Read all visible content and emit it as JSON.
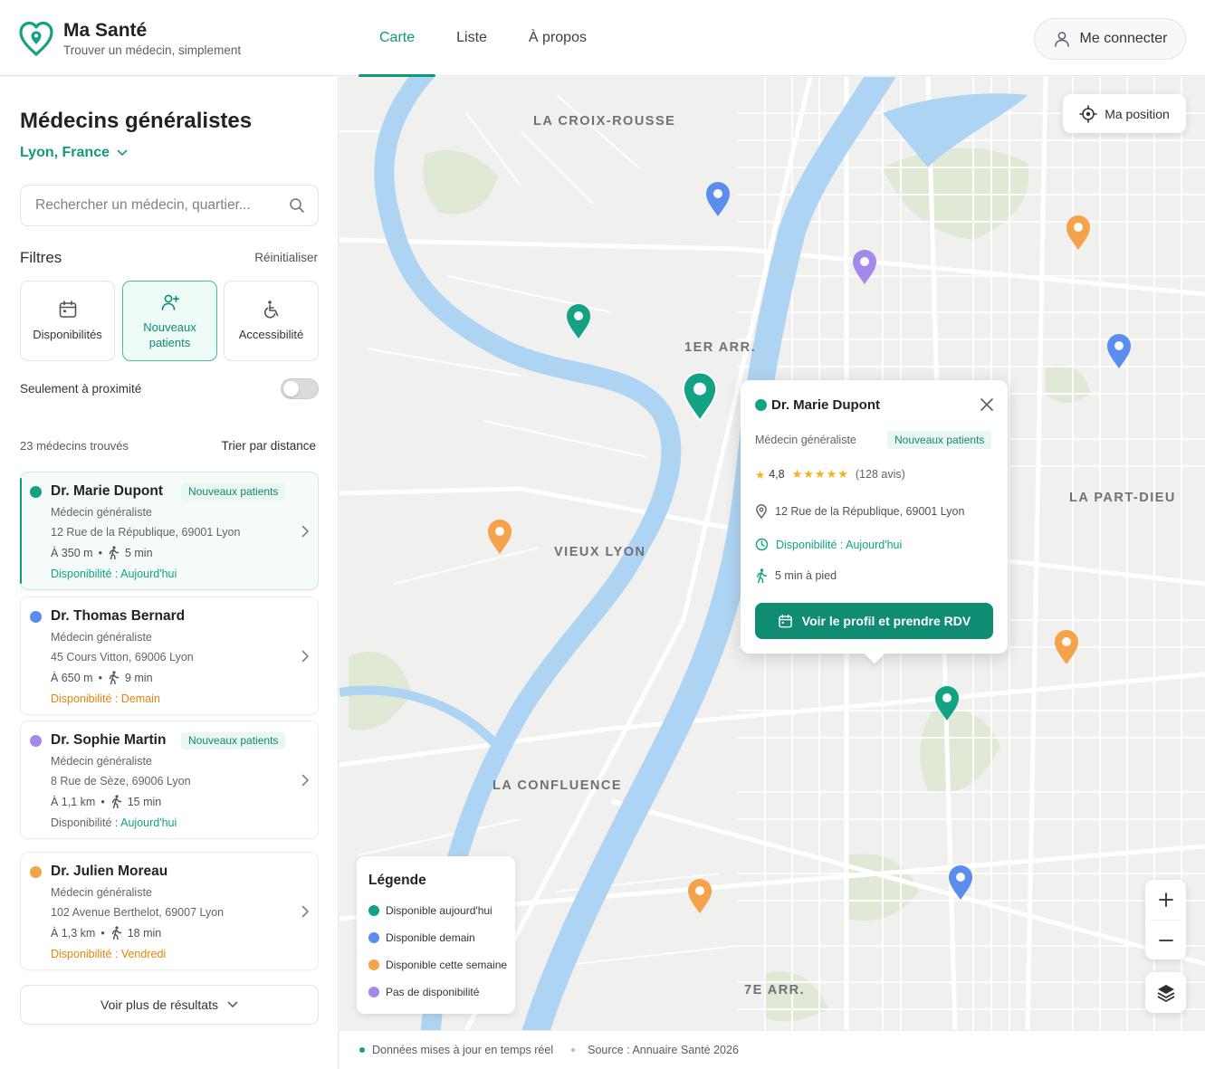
{
  "app": {
    "title": "Ma Santé",
    "subtitle": "Trouver un médecin, simplement"
  },
  "nav": {
    "tabs": [
      {
        "label": "Carte",
        "active": true
      },
      {
        "label": "Liste",
        "active": false
      },
      {
        "label": "À propos",
        "active": false
      }
    ],
    "login_label": "Me connecter"
  },
  "sidebar": {
    "title": "Médecins généralistes",
    "city": "Lyon, France",
    "search_placeholder": "Rechercher un médecin, quartier...",
    "filters_title": "Filtres",
    "reset_label": "Réinitialiser",
    "filters": [
      {
        "label": "Disponibilités",
        "active": false,
        "icon": "calendar-icon"
      },
      {
        "label": "Nouveaux patients",
        "active": true,
        "icon": "user-plus-icon"
      },
      {
        "label": "Accessibilité",
        "active": false,
        "icon": "wheelchair-icon"
      }
    ],
    "proximity_label": "Seulement à proximité",
    "proximity_on": false,
    "results_count": "23 médecins trouvés",
    "sort_label": "Trier par distance",
    "more_label": "Voir plus de résultats"
  },
  "doctors": [
    {
      "name": "Dr. Marie Dupont",
      "badge": "Nouveaux patients",
      "specialty": "Médecin généraliste",
      "address": "12 Rue de la République, 69001 Lyon",
      "distance": "À 350 m",
      "walk": "5 min",
      "availability_prefix": "Disponibilité : ",
      "availability": "Aujourd'hui",
      "color": "#13a283",
      "prefix_color": "#13a283",
      "avail_color": "#13a283",
      "selected": true
    },
    {
      "name": "Dr. Thomas Bernard",
      "badge": "",
      "specialty": "Médecin généraliste",
      "address": "45 Cours Vitton, 69006 Lyon",
      "distance": "À 650 m",
      "walk": "9 min",
      "availability_prefix": "Disponibilité : ",
      "availability": "Demain",
      "color": "#5b8def",
      "prefix_color": "#e8830c",
      "avail_color": "#e8830c",
      "selected": false
    },
    {
      "name": "Dr. Sophie Martin",
      "badge": "Nouveaux patients",
      "specialty": "Médecin généraliste",
      "address": "8 Rue de Sèze, 69006 Lyon",
      "distance": "À 1,1 km",
      "walk": "15 min",
      "availability_prefix": "Disponibilité : ",
      "availability": "Aujourd'hui",
      "color": "#a38ae8",
      "prefix_color": "#5f656b",
      "avail_color": "#13a283",
      "selected": false
    },
    {
      "name": "Dr. Julien Moreau",
      "badge": "",
      "specialty": "Médecin généraliste",
      "address": "102 Avenue Berthelot, 69007 Lyon",
      "distance": "À 1,3 km",
      "walk": "18 min",
      "availability_prefix": "Disponibilité : ",
      "availability": "Vendredi",
      "color": "#f4a24c",
      "prefix_color": "#e8830c",
      "avail_color": "#e8830c",
      "selected": false
    }
  ],
  "map": {
    "position_label": "Ma position",
    "districts": [
      "LA CROIX-ROUSSE",
      "1ER ARR.",
      "LA PART-DIEU",
      "VIEUX LYON",
      "LA CONFLUENCE",
      "7E ARR."
    ],
    "colors": {
      "today": "#13a283",
      "tomorrow": "#5b8def",
      "week": "#f4a24c",
      "none": "#a38ae8",
      "water": "#aed4f3"
    }
  },
  "popup": {
    "name": "Dr. Marie Dupont",
    "specialty": "Médecin généraliste",
    "badge": "Nouveaux patients",
    "rating": "4,8",
    "stars": 5,
    "reviews": "(128 avis)",
    "address": "12 Rue de la République, 69001 Lyon",
    "availability": "Disponibilité : Aujourd'hui",
    "walk": "5 min à pied",
    "cta": "Voir le profil et prendre RDV"
  },
  "legend": {
    "title": "Légende",
    "items": [
      {
        "label": "Disponible aujourd'hui",
        "color": "#13a283"
      },
      {
        "label": "Disponible demain",
        "color": "#5b8def"
      },
      {
        "label": "Disponible cette semaine",
        "color": "#f4a24c"
      },
      {
        "label": "Pas de disponibilité",
        "color": "#a38ae8"
      }
    ]
  },
  "footer": {
    "realtime": "Données mises à jour en temps réel",
    "source": "Source : Annuaire Santé 2026"
  }
}
